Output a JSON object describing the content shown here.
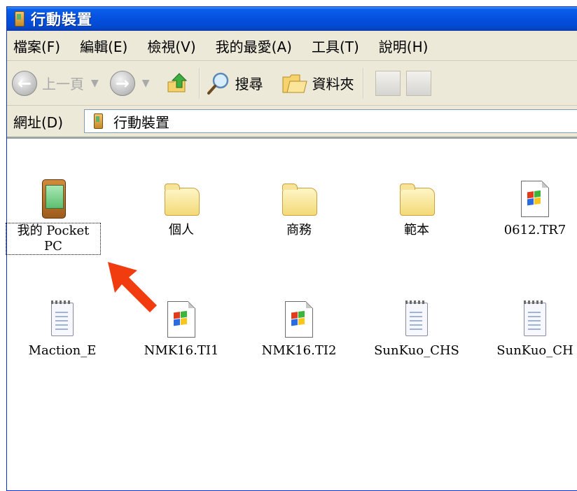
{
  "window": {
    "title": "行動裝置"
  },
  "menubar": {
    "items": [
      "檔案(F)",
      "編輯(E)",
      "檢視(V)",
      "我的最愛(A)",
      "工具(T)",
      "說明(H)"
    ]
  },
  "toolbar": {
    "back_label": "上一頁",
    "search_label": "搜尋",
    "folders_label": "資料夾"
  },
  "address": {
    "label": "網址(D)",
    "value": "行動裝置"
  },
  "files": [
    {
      "name": "我的 Pocket PC",
      "line1": "我的 Pocket",
      "line2": "PC",
      "icon": "pocket-pc-icon",
      "selected": true
    },
    {
      "name": "個人",
      "icon": "folder-icon"
    },
    {
      "name": "商務",
      "icon": "folder-icon"
    },
    {
      "name": "範本",
      "icon": "folder-icon"
    },
    {
      "name": "0612.TR7",
      "icon": "document-icon"
    },
    {
      "name": "Maction_E",
      "icon": "notepad-icon"
    },
    {
      "name": "NMK16.TI1",
      "icon": "document-icon"
    },
    {
      "name": "NMK16.TI2",
      "icon": "document-icon"
    },
    {
      "name": "SunKuo_CHS",
      "icon": "notepad-icon"
    },
    {
      "name": "SunKuo_CH",
      "icon": "notepad-icon"
    }
  ],
  "annotation": {
    "arrow_color": "#f03c0f"
  }
}
